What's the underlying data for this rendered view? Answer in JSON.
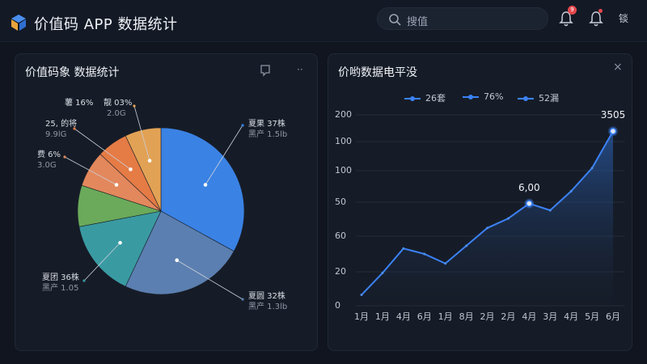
{
  "header": {
    "app_title": "价值码 APP 数据统计",
    "search_placeholder": "搜值",
    "notification_count": "9",
    "right_text": "锬"
  },
  "left_panel": {
    "title": "价值码象 数据统计",
    "slices": [
      {
        "label": "夏果 37株",
        "sublabel": "黑产 1.5lb",
        "value": 33,
        "color": "#3a82e4"
      },
      {
        "label": "夏圆 32株",
        "sublabel": "黑产 1.3lb",
        "value": 24,
        "color": "#5b7fb0"
      },
      {
        "label": "夏团 36株",
        "sublabel": "黑产 1.05",
        "value": 15,
        "color": "#3a9aa2"
      },
      {
        "label": "",
        "sublabel": "",
        "value": 8,
        "color": "#6aaa5a"
      },
      {
        "label": "费 6%",
        "sublabel": "3.0G",
        "value": 7,
        "color": "#e3885c"
      },
      {
        "label": "25, 的将",
        "sublabel": "9.9lG",
        "value": 6,
        "color": "#e57b45"
      },
      {
        "label": "薯 16%",
        "sublabel": "2.0G",
        "value": 7,
        "color": "#e2a255"
      }
    ],
    "extra_label": {
      "label": "靓 03%",
      "sublabel": ""
    }
  },
  "right_panel": {
    "title": "价哟数据电平没",
    "legend": [
      "26套",
      "76%",
      "52漏"
    ]
  },
  "chart_data": {
    "type": "area",
    "x": [
      "1月",
      "1月",
      "4月",
      "6月",
      "1月",
      "8月",
      "2月",
      "2月",
      "4月",
      "3月",
      "4月",
      "5月",
      "6月"
    ],
    "y_tick_labels": [
      "0",
      "20",
      "60",
      "50",
      "100",
      "100",
      "200"
    ],
    "values": [
      8,
      24,
      42,
      38,
      31,
      44,
      57,
      64,
      75,
      70,
      84,
      101,
      128
    ],
    "annotations": [
      {
        "text": "6,00",
        "index": 8
      },
      {
        "text": "3505",
        "index": 12
      }
    ],
    "series": [
      {
        "name": "",
        "color": "#3b82f6"
      }
    ],
    "grid": true
  }
}
